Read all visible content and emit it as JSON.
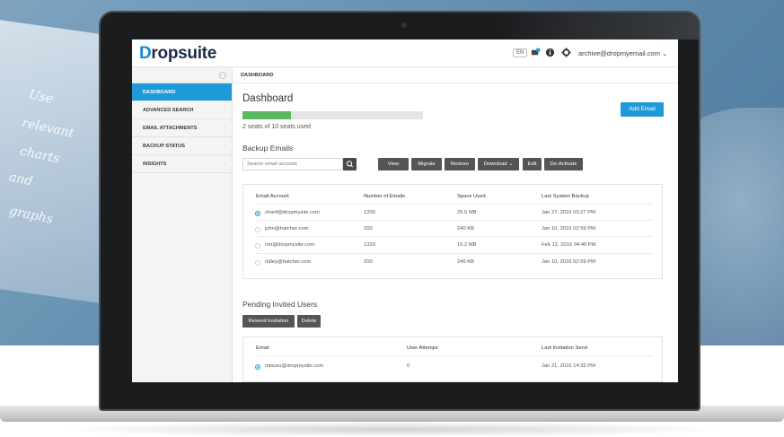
{
  "background": {
    "words": [
      "Use",
      "relevant",
      "charts",
      "and",
      "graphs"
    ]
  },
  "app": {
    "logo_d": "D",
    "logo_rest": "ropsuite",
    "language": "EN",
    "user_email": "archive@dropmyemail.com",
    "icons": [
      "notification-icon",
      "info-icon",
      "gear-icon",
      "chevron-down-icon"
    ]
  },
  "sidebar": {
    "items": [
      {
        "label": "DASHBOARD",
        "active": true
      },
      {
        "label": "ADVANCED SEARCH",
        "active": false
      },
      {
        "label": "EMAIL ATTACHMENTS",
        "active": false
      },
      {
        "label": "BACKUP STATUS",
        "active": false
      },
      {
        "label": "INSIGHTS",
        "active": false
      }
    ]
  },
  "main": {
    "breadcrumb": "DASHBOARD",
    "title": "Dashboard",
    "add_email_label": "Add Email",
    "seats_used_fraction": 0.27,
    "seats_text": "2 seats of 10 seats used",
    "backup_title": "Backup Emails",
    "search_placeholder": "Search email account",
    "actions": [
      "View",
      "Migrate",
      "Restore",
      "Download",
      "Edit",
      "De-Activate"
    ],
    "accent_color": "#1f9ad8",
    "backup_table": {
      "headers": [
        "Email Account",
        "Number of Emails",
        "Space Used",
        "Last System Backup"
      ],
      "rows": [
        {
          "email": "charif@dropmysite.com",
          "count": "1200",
          "space": "25.5 MB",
          "last": "Jan 27, 2016 03:27 PM",
          "selected": true
        },
        {
          "email": "john@hatcher.com",
          "count": "200",
          "space": "240 KB",
          "last": "Jan 10, 2016 02:59 PM",
          "selected": false
        },
        {
          "email": "ron@dropmysite.com",
          "count": "1320",
          "space": "15.2 MB",
          "last": "Feb 12, 2016 04:40 PM",
          "selected": false
        },
        {
          "email": "ridley@hatcher.com",
          "count": "200",
          "space": "240 KB",
          "last": "Jan 10, 2016 02:59 PM",
          "selected": false
        }
      ]
    },
    "pending_title": "Pending Invited Users",
    "pending_actions": [
      "Resend Invitation",
      "Delete"
    ],
    "pending_table": {
      "headers": [
        "Email",
        "User Attemps",
        "Last Invitation Send"
      ],
      "rows": [
        {
          "email": "misuzu@dropmysite.com",
          "attempts": "0",
          "last": "Jan 21, 2016 14:32 PM",
          "selected": true
        }
      ]
    }
  }
}
